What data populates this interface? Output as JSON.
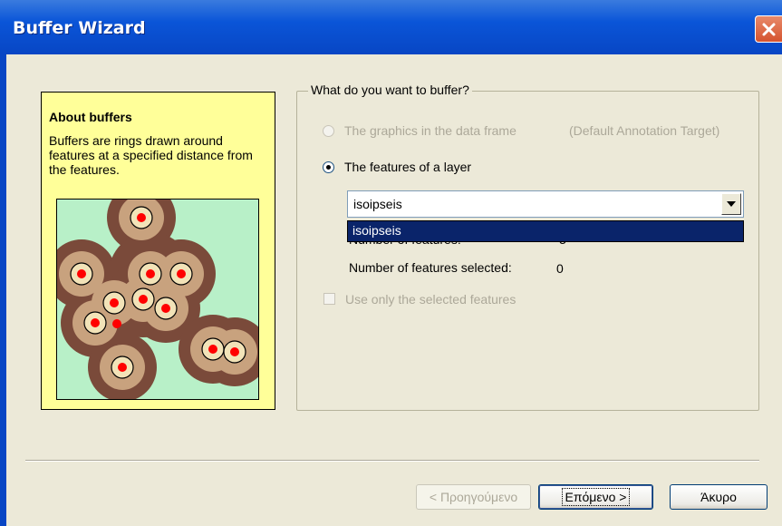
{
  "window": {
    "title": "Buffer Wizard",
    "close_icon": "close-icon"
  },
  "about": {
    "title": "About buffers",
    "description": "Buffers are rings drawn around features at a specified distance from the features."
  },
  "group": {
    "legend": "What do you want to buffer?",
    "option_graphics": {
      "label": "The graphics in the data frame",
      "note": "(Default Annotation Target)",
      "checked": false,
      "enabled": false
    },
    "option_features": {
      "label": "The features of a layer",
      "checked": true,
      "enabled": true
    },
    "layer_select": {
      "value": "isoipseis",
      "dropdown_open": true,
      "options": [
        "isoipseis"
      ]
    },
    "num_features": {
      "label": "Number of features:",
      "value": "3"
    },
    "num_selected": {
      "label": "Number of features selected:",
      "value": "0"
    },
    "use_selected": {
      "label": "Use only the selected features",
      "checked": false,
      "enabled": false
    }
  },
  "buttons": {
    "back": "< Προηγούμενο",
    "next": "Επόμενο >",
    "cancel": "Άκυρο"
  },
  "colors": {
    "titlebar": "#0A55D8",
    "about_bg": "#FFFF99",
    "highlight": "#0A246A",
    "buffer_dark": "#7A4A3A",
    "buffer_light": "#C8A27E",
    "point": "#FF0000"
  }
}
